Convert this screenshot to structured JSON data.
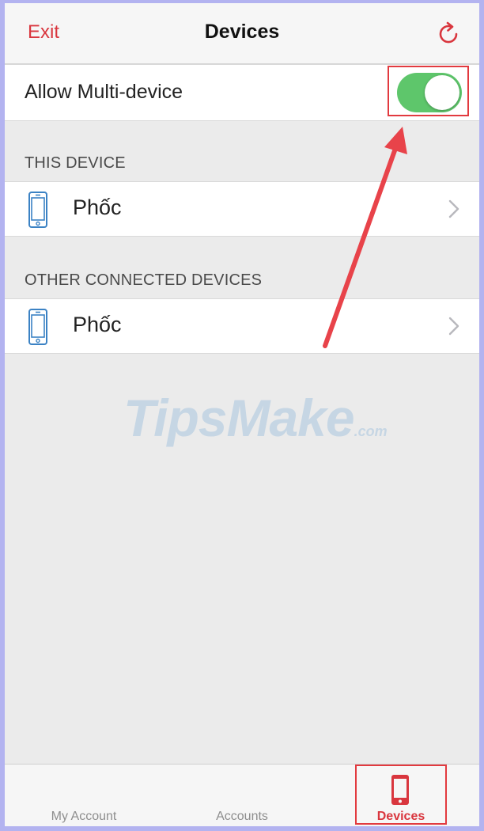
{
  "navbar": {
    "exit_label": "Exit",
    "title": "Devices",
    "refresh_icon": "refresh-icon"
  },
  "settings": {
    "multi_device_label": "Allow Multi-device",
    "multi_device_enabled": true
  },
  "sections": [
    {
      "header": "THIS DEVICE",
      "devices": [
        {
          "name": "Phốc",
          "icon": "phone-icon"
        }
      ]
    },
    {
      "header": "OTHER CONNECTED DEVICES",
      "devices": [
        {
          "name": "Phốc",
          "icon": "phone-icon"
        }
      ]
    }
  ],
  "watermark": {
    "main": "TipsMake",
    "suffix": ".com"
  },
  "tabbar": {
    "tabs": [
      {
        "label": "My Account",
        "active": false
      },
      {
        "label": "Accounts",
        "active": false
      },
      {
        "label": "Devices",
        "active": true
      }
    ]
  },
  "colors": {
    "accent": "#d9363e",
    "switch_on": "#5ec66b",
    "device_icon": "#3b82c4",
    "annotation": "#e23a3f"
  }
}
